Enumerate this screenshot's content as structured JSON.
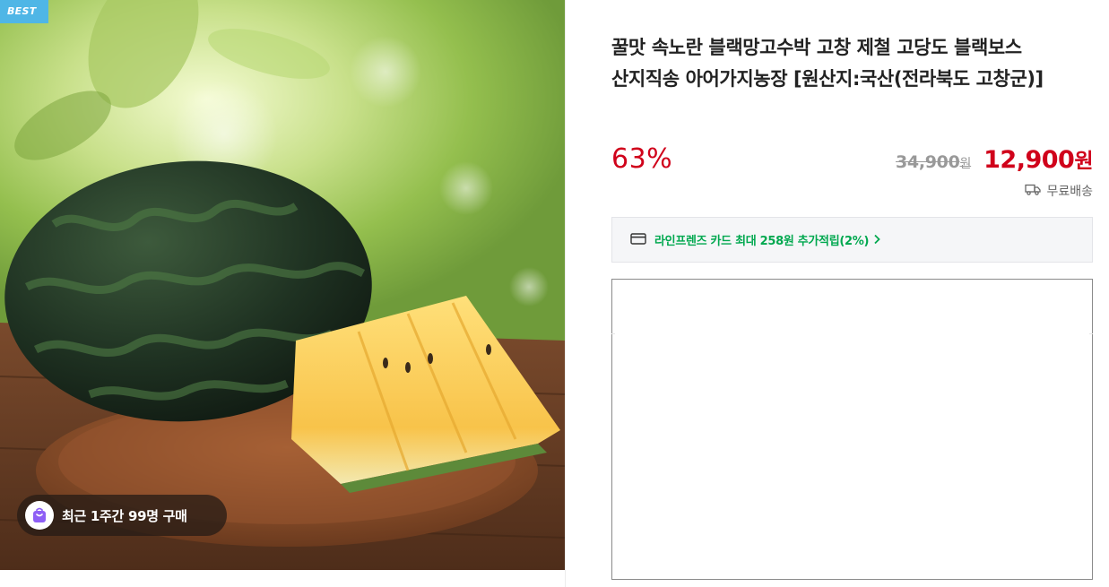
{
  "image": {
    "badge": "BEST",
    "subject": "watermelon-image",
    "purchase_badge": "최근 1주간 99명 구매"
  },
  "product": {
    "title": "꿀맛 속노란 블랙망고수박 고창 제철 고당도 블랙보스 산지직송 아어가지농장 [원산지:국산(전라북도 고창군)]",
    "discount_rate": "63%",
    "original_price": "34,900",
    "original_price_unit": "원",
    "sale_price": "12,900",
    "sale_price_unit": "원",
    "shipping": "무료배송"
  },
  "benefit": {
    "text": "라인프렌즈 카드 최대 258원 추가적립(2%)"
  },
  "icons": {
    "bag": "shopping-bag-icon",
    "truck": "delivery-truck-icon",
    "card": "credit-card-icon",
    "chevron": "chevron-right-icon"
  },
  "colors": {
    "accent_red": "#d0021b",
    "benefit_green": "#00a84f",
    "badge_blue": "#4fb6e6",
    "bag_purple": "#8e5ff5"
  }
}
